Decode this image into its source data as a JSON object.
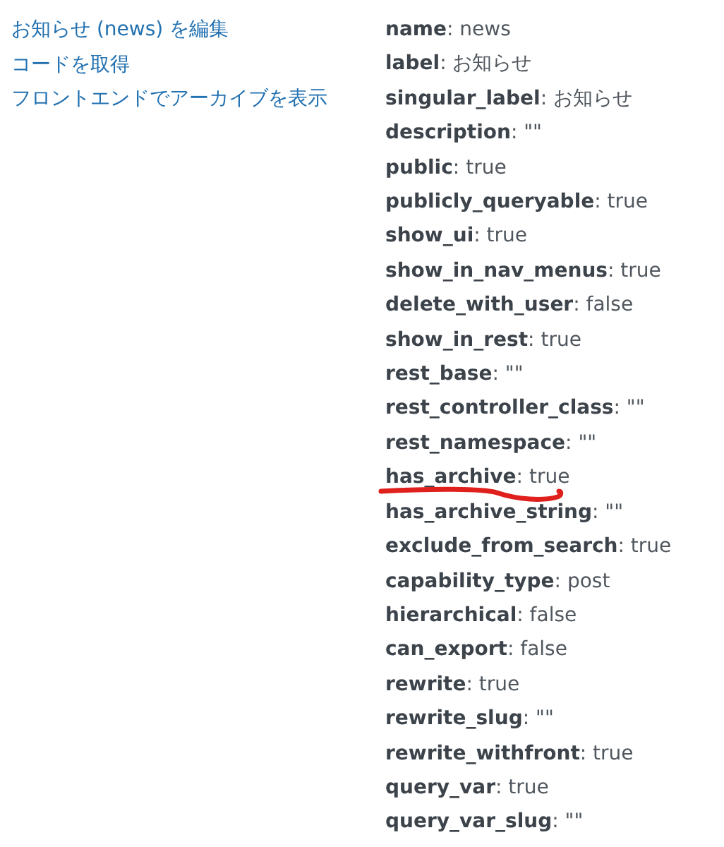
{
  "links": [
    "お知らせ (news) を編集",
    "コードを取得",
    "フロントエンドでアーカイブを表示"
  ],
  "properties": [
    {
      "text": "**name**: news",
      "underlined": false
    },
    {
      "text": "**label**: お知らせ",
      "underlined": false
    },
    {
      "text": "**singular_label**: お知らせ",
      "underlined": false
    },
    {
      "text": "**description**: \"\"",
      "underlined": false
    },
    {
      "text": "**public**: true",
      "underlined": false
    },
    {
      "text": "**publicly_queryable**: true",
      "underlined": false
    },
    {
      "text": "**show_ui**: true",
      "underlined": false
    },
    {
      "text": "**show_in_nav_menus**: true",
      "underlined": false
    },
    {
      "text": "**delete_with_user**: false",
      "underlined": false
    },
    {
      "text": "**show_in_rest**: true",
      "underlined": false
    },
    {
      "text": "**rest_base**: \"\"",
      "underlined": false
    },
    {
      "text": "**rest_controller_class**: \"\"",
      "underlined": false
    },
    {
      "text": "**rest_namespace**: \"\"",
      "underlined": false
    },
    {
      "text": "**has_archive**: true",
      "underlined": true
    },
    {
      "text": "**has_archive_string**: \"\"",
      "underlined": false
    },
    {
      "text": "**exclude_from_search**: true",
      "underlined": false
    },
    {
      "text": "**capability_type**: post",
      "underlined": false
    },
    {
      "text": "**hierarchical**: false",
      "underlined": false
    },
    {
      "text": "**can_export**: false",
      "underlined": false
    },
    {
      "text": "**rewrite**: true",
      "underlined": false
    },
    {
      "text": "**rewrite_slug**: \"\"",
      "underlined": false
    },
    {
      "text": "**rewrite_withfront**: true",
      "underlined": false
    },
    {
      "text": "**query_var**: true",
      "underlined": false
    },
    {
      "text": "**query_var_slug**: \"\"",
      "underlined": false
    }
  ]
}
